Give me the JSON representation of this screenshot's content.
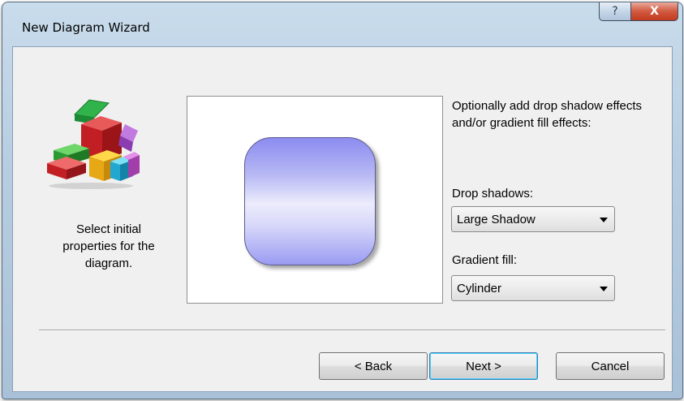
{
  "window": {
    "title": "New Diagram Wizard",
    "help_glyph": "?",
    "close_glyph": "X"
  },
  "left_panel": {
    "description": "Select initial properties for the diagram.",
    "logo_icon": "colored-blocks-icon"
  },
  "preview": {
    "shape": "rounded-rectangle",
    "fill": "cylinder-gradient",
    "shadow": "large"
  },
  "options": {
    "intro": "Optionally add drop shadow effects and/or gradient fill effects:",
    "drop_shadows_label": "Drop shadows:",
    "drop_shadows_value": "Large Shadow",
    "gradient_fill_label": "Gradient fill:",
    "gradient_fill_value": "Cylinder"
  },
  "buttons": {
    "back": "< Back",
    "next": "Next >",
    "cancel": "Cancel"
  },
  "colors": {
    "accent": "#3c7fb1",
    "shape_fill": "#8b8cf0",
    "close_button": "#c23a1e"
  }
}
